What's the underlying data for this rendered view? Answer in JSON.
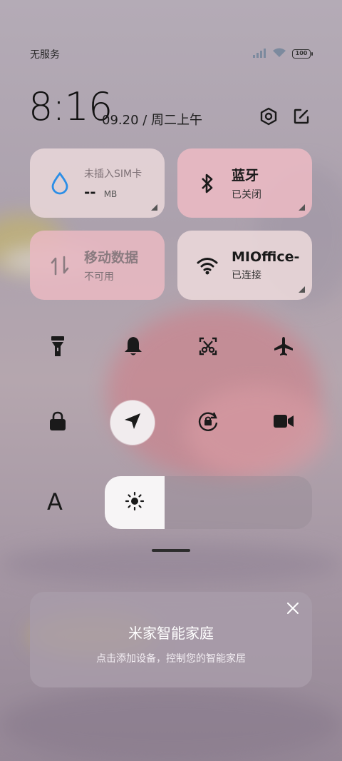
{
  "status_bar": {
    "carrier": "无服务",
    "battery": "100"
  },
  "header": {
    "time": "8:16",
    "date": "09.20 / 周二上午"
  },
  "tiles": {
    "sim": {
      "title": "未插入SIM卡",
      "value": "--",
      "unit": "MB"
    },
    "bluetooth": {
      "title": "蓝牙",
      "status": "已关闭"
    },
    "mobile_data": {
      "title": "移动数据",
      "status": "不可用"
    },
    "wifi": {
      "title": "MIOffice-",
      "status": "已连接"
    }
  },
  "font_label": "A",
  "brightness_level": 0.29,
  "smart_home": {
    "title": "米家智能家庭",
    "subtitle": "点击添加设备，控制您的智能家居"
  }
}
